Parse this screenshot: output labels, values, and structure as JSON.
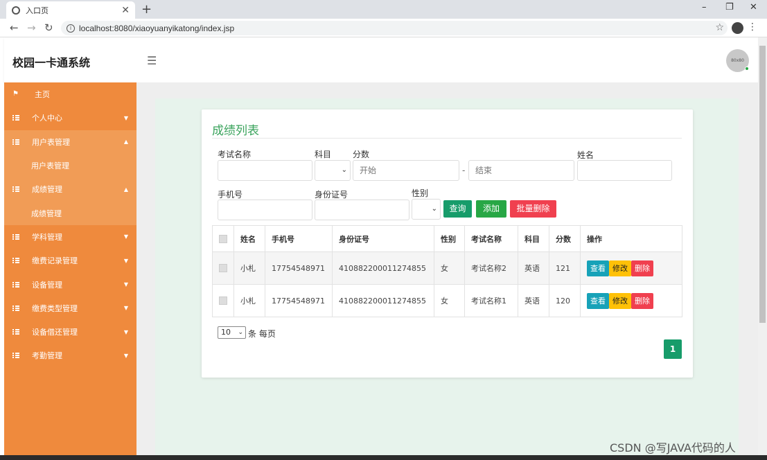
{
  "browser": {
    "tab_title": "入口页",
    "url": "localhost:8080/xiaoyuanyikatong/index.jsp"
  },
  "header": {
    "brand": "校园一卡通系统",
    "avatar_text": "80x80"
  },
  "sidebar": {
    "items": [
      {
        "label": "主页",
        "type": "home"
      },
      {
        "label": "个人中心",
        "type": "group"
      },
      {
        "label": "用户表管理",
        "type": "group-open"
      },
      {
        "label": "用户表管理",
        "type": "sub"
      },
      {
        "label": "成绩管理",
        "type": "group-open"
      },
      {
        "label": "成绩管理",
        "type": "sub"
      },
      {
        "label": "学科管理",
        "type": "group"
      },
      {
        "label": "缴费记录管理",
        "type": "group"
      },
      {
        "label": "设备管理",
        "type": "group"
      },
      {
        "label": "缴费类型管理",
        "type": "group"
      },
      {
        "label": "设备借还管理",
        "type": "group"
      },
      {
        "label": "考勤管理",
        "type": "group"
      }
    ]
  },
  "card": {
    "title": "成绩列表"
  },
  "filters": {
    "exam_name_label": "考试名称",
    "subject_label": "科目",
    "score_label": "分数",
    "score_start_placeholder": "开始",
    "score_dash": "-",
    "score_end_placeholder": "结束",
    "name_label": "姓名",
    "phone_label": "手机号",
    "id_card_label": "身份证号",
    "gender_label": "性别",
    "query_button": "查询",
    "add_button": "添加",
    "batch_delete_button": "批量删除"
  },
  "table": {
    "headers": [
      "姓名",
      "手机号",
      "身份证号",
      "性别",
      "考试名称",
      "科目",
      "分数",
      "操作"
    ],
    "rows": [
      {
        "name": "小札",
        "phone": "17754548971",
        "id_card": "410882200011274855",
        "gender": "女",
        "exam": "考试名称2",
        "subject": "英语",
        "score": "121"
      },
      {
        "name": "小札",
        "phone": "17754548971",
        "id_card": "410882200011274855",
        "gender": "女",
        "exam": "考试名称1",
        "subject": "英语",
        "score": "120"
      }
    ],
    "actions": {
      "view": "查看",
      "edit": "修改",
      "delete": "删除"
    }
  },
  "pagination": {
    "page_size": "10",
    "per_page_label": "条 每页",
    "current_page": "1"
  },
  "watermark": "CSDN @写JAVA代码的人"
}
